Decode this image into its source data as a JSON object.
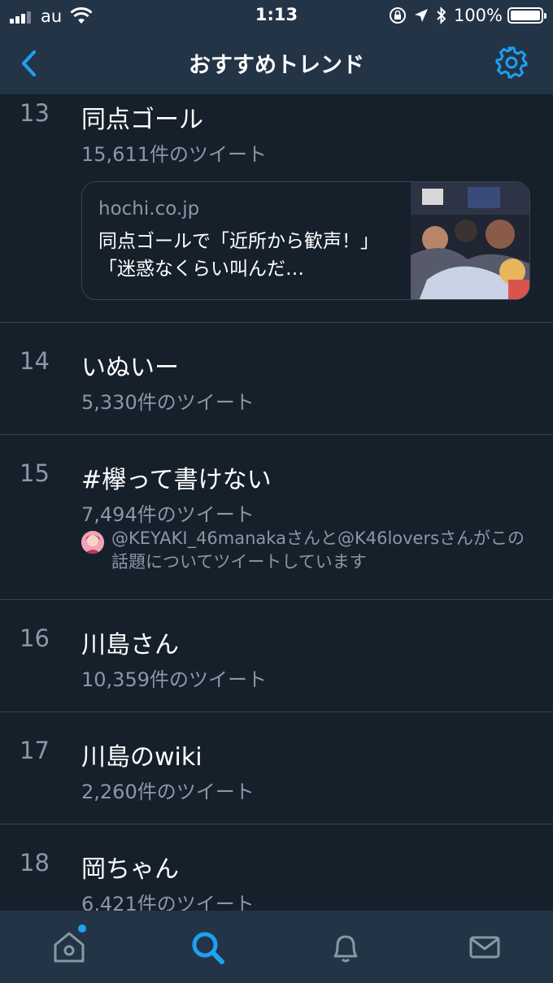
{
  "status_bar": {
    "carrier": "au",
    "time": "1:13",
    "battery": "100%"
  },
  "nav": {
    "title": "おすすめトレンド"
  },
  "trends": [
    {
      "rank": "13",
      "name": "同点ゴール",
      "count": "15,611件のツイート",
      "card": {
        "domain": "hochi.co.jp",
        "headline": "同点ゴールで「近所から歓声！」「迷惑なくらい叫んだ…"
      }
    },
    {
      "rank": "14",
      "name": "いぬいー",
      "count": "5,330件のツイート"
    },
    {
      "rank": "15",
      "name": "#欅って書けない",
      "count": "7,494件のツイート",
      "context": "@KEYAKI_46manakaさんと@K46loversさんがこの話題についてツイートしています"
    },
    {
      "rank": "16",
      "name": "川島さん",
      "count": "10,359件のツイート"
    },
    {
      "rank": "17",
      "name": "川島のwiki",
      "count": "2,260件のツイート"
    },
    {
      "rank": "18",
      "name": "岡ちゃん",
      "count": "6,421件のツイート"
    }
  ],
  "colors": {
    "background": "#15202b",
    "bar": "#243447",
    "accent": "#1da1f2",
    "secondary_text": "#8899a6",
    "divider": "#38444d"
  },
  "icons": {
    "back": "chevron-left-icon",
    "settings": "gear-icon",
    "home": "home-icon",
    "search": "search-icon",
    "notifications": "bell-icon",
    "messages": "envelope-icon"
  }
}
